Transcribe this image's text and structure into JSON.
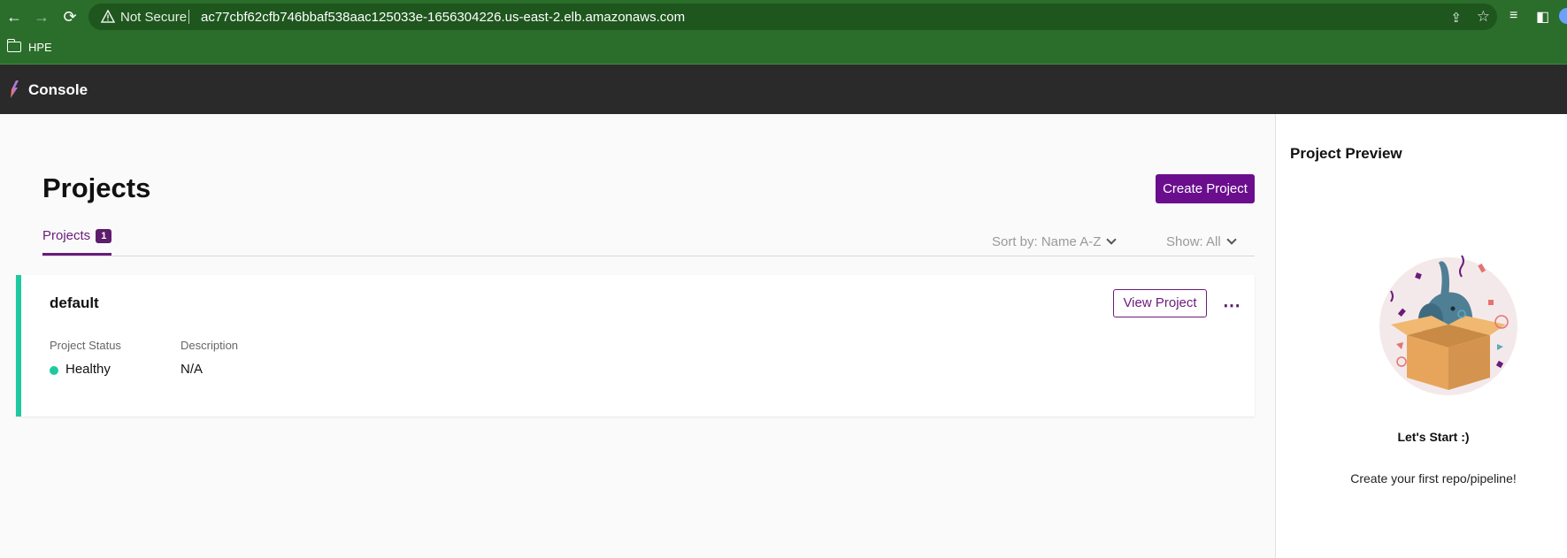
{
  "browser": {
    "nav_back": "←",
    "nav_forward": "→",
    "nav_reload": "⟳",
    "security_label": "Not Secure",
    "url": "ac77cbf62cfb746bbaf538aac125033e-1656304226.us-east-2.elb.amazonaws.com",
    "bookmarks": [
      {
        "label": "HPE",
        "icon": "folder-icon"
      }
    ],
    "theme_color": "#2b6d2b"
  },
  "app": {
    "title": "Console",
    "header_color": "#2a2a2a"
  },
  "main": {
    "page_title": "Projects",
    "create_button": "Create Project",
    "accent_color": "#6a0e8e",
    "tabs": [
      {
        "label": "Projects",
        "count": "1"
      }
    ],
    "sort_label": "Sort by: Name A-Z",
    "show_label": "Show: All",
    "projects": [
      {
        "name": "default",
        "view_button": "View  Project",
        "more_icon": "⋯",
        "status_label": "Project Status",
        "status_value": "Healthy",
        "status_color": "#1fc9a0",
        "description_label": "Description",
        "description_value": "N/A"
      }
    ]
  },
  "preview": {
    "title": "Project Preview",
    "illustration": "elephant-in-box-confetti",
    "heading": "Let's Start :)",
    "subtitle": "Create your first repo/pipeline!"
  }
}
